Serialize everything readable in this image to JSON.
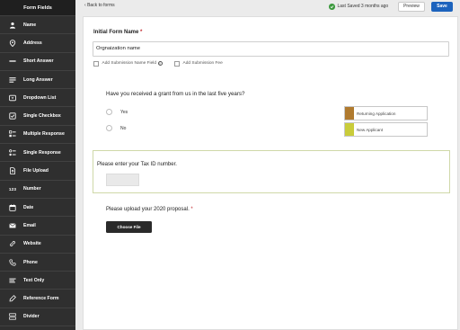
{
  "sidebar": {
    "title": "Form Fields",
    "items": [
      {
        "label": "Name",
        "icon": "person-icon"
      },
      {
        "label": "Address",
        "icon": "map-pin-icon"
      },
      {
        "label": "Short Answer",
        "icon": "short-answer-icon"
      },
      {
        "label": "Long Answer",
        "icon": "long-answer-icon"
      },
      {
        "label": "Dropdown List",
        "icon": "dropdown-icon"
      },
      {
        "label": "Single Checkbox",
        "icon": "checkbox-icon"
      },
      {
        "label": "Multiple Response",
        "icon": "multiple-response-icon"
      },
      {
        "label": "Single Response",
        "icon": "single-response-icon"
      },
      {
        "label": "File Upload",
        "icon": "file-upload-icon"
      },
      {
        "label": "Number",
        "icon": "number-icon",
        "icon_text": "123"
      },
      {
        "label": "Date",
        "icon": "calendar-icon"
      },
      {
        "label": "Email",
        "icon": "email-icon"
      },
      {
        "label": "Website",
        "icon": "link-icon"
      },
      {
        "label": "Phone",
        "icon": "phone-icon"
      },
      {
        "label": "Text Only",
        "icon": "text-only-icon"
      },
      {
        "label": "Reference Form",
        "icon": "reference-form-icon"
      },
      {
        "label": "Divider",
        "icon": "divider-icon"
      }
    ]
  },
  "topbar": {
    "back_label": "Back to forms",
    "saved_label": "Last Saved 3 months ago",
    "preview_label": "Preview",
    "save_label": "Save"
  },
  "form": {
    "name_label": "Initial Form Name",
    "required_mark": "*",
    "name_value": "Orgnaization name",
    "opt_submission_name": "Add Submission Name Field",
    "opt_submission_fee": "Add Submission Fee",
    "info_glyph": "i",
    "question": "Have you received a grant from us in the last five years?",
    "options": [
      "Yes",
      "No"
    ],
    "branches": [
      {
        "label": "Returning Application",
        "color": "#b07a2e"
      },
      {
        "label": "New Applicant",
        "color": "#c9cc3a"
      }
    ],
    "tax_label": "Please enter your Tax ID number.",
    "upload_label": "Please upload your 2020 proposal.",
    "choose_file_label": "Choose File"
  },
  "colors": {
    "accent": "#1d63bd",
    "success": "#3d9a3f",
    "sidebar_bg": "#2f2f2f",
    "required": "#c0262d"
  }
}
